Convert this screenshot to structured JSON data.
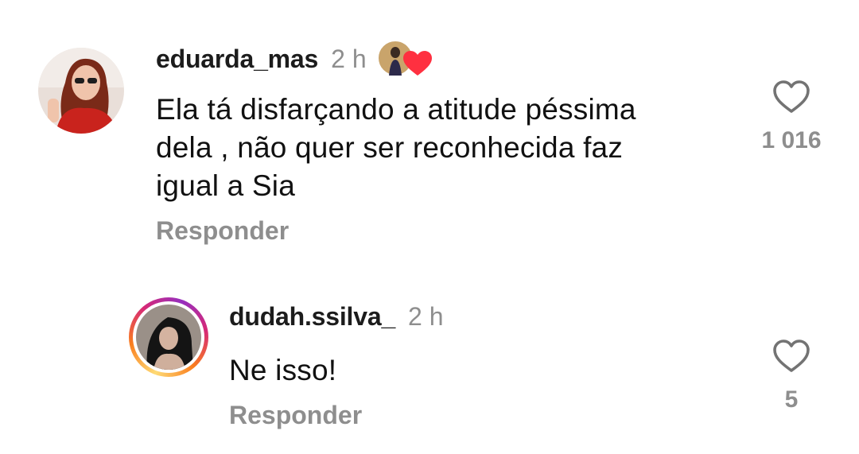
{
  "comments": [
    {
      "username": "eduarda_mas",
      "time": "2 h",
      "text_lines": [
        "Ela tá disfarçando a atitude péssima",
        "dela , não quer ser reconhecida faz",
        "igual a Sia"
      ],
      "reply_label": "Responder",
      "like_count": "1 016",
      "liked_by_author": true,
      "avatar_icon": "profile-photo"
    },
    {
      "username": "dudah.ssilva_",
      "time": "2 h",
      "text_lines": [
        "Ne isso!"
      ],
      "reply_label": "Responder",
      "like_count": "5",
      "has_story_ring": true,
      "avatar_icon": "profile-photo"
    }
  ],
  "icons": {
    "like": "heart-outline-icon",
    "author_like": "red-heart-icon"
  },
  "colors": {
    "muted": "#8e8e8e",
    "heart_red": "#ff3040",
    "story_ring": [
      "#feda75",
      "#fa7e1e",
      "#d62976",
      "#962fbf"
    ]
  }
}
